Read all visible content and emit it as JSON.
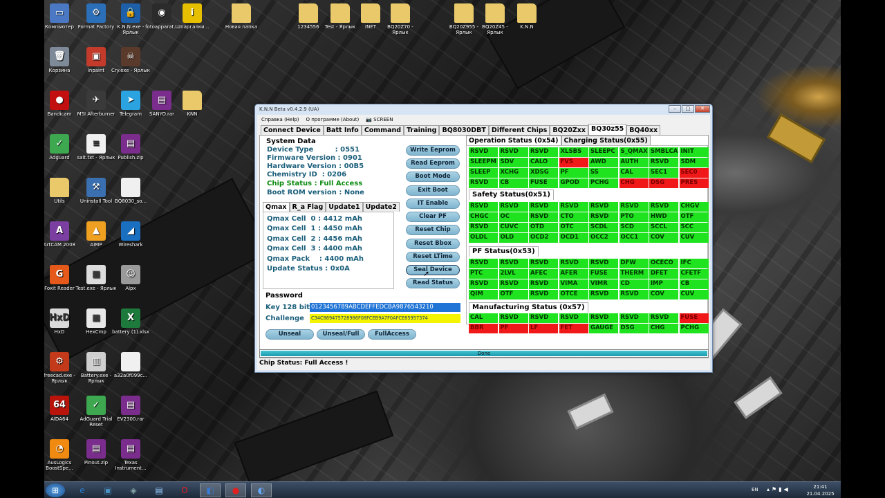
{
  "desktop_icons": [
    {
      "label": "Компьютер",
      "icon": "computer-icon",
      "glyph": "▭",
      "bg": "#4b78c2"
    },
    {
      "label": "Format Factory",
      "icon": "format-factory-icon",
      "glyph": "⚙",
      "bg": "#2a6fb8"
    },
    {
      "label": "K.N.N.exe - Ярлык",
      "icon": "lock-icon",
      "glyph": "🔒",
      "bg": "#1d5fa8"
    },
    {
      "label": "fotoapparat...",
      "icon": "camera-icon",
      "glyph": "◉",
      "bg": "#2b2b2b"
    },
    {
      "label": "Шпаргалки...",
      "icon": "info-icon",
      "glyph": "i",
      "bg": "#e6c000"
    },
    {
      "label": "Новая папка",
      "icon": "folder-icon",
      "glyph": "",
      "bg": "#e9c96a"
    },
    {
      "label": "1234556",
      "icon": "folder-icon",
      "glyph": "",
      "bg": "#e9c96a"
    },
    {
      "label": "Test - Ярлык",
      "icon": "folder-icon",
      "glyph": "",
      "bg": "#e9c96a"
    },
    {
      "label": "INET",
      "icon": "folder-icon",
      "glyph": "",
      "bg": "#e9c96a"
    },
    {
      "label": "BQ20Z70 - Ярлык",
      "icon": "folder-icon",
      "glyph": "",
      "bg": "#e9c96a"
    },
    {
      "label": "BQ20Z955 - Ярлык",
      "icon": "folder-icon",
      "glyph": "",
      "bg": "#e9c96a"
    },
    {
      "label": "BQ20Z45 - Ярлык",
      "icon": "folder-icon",
      "glyph": "",
      "bg": "#e9c96a"
    },
    {
      "label": "K.N.N",
      "icon": "folder-icon",
      "glyph": "",
      "bg": "#e9c96a"
    },
    {
      "label": "Корзина",
      "icon": "recycle-bin-icon",
      "glyph": "🗑",
      "bg": "#7f8a99"
    },
    {
      "label": "Inpaint",
      "icon": "inpaint-icon",
      "glyph": "▣",
      "bg": "#c43b2c"
    },
    {
      "label": "Cry.exe - Ярлык",
      "icon": "cry-icon",
      "glyph": "☠",
      "bg": "#5a3a2a"
    },
    {
      "label": "Bandicam",
      "icon": "bandicam-icon",
      "glyph": "●",
      "bg": "#c21010"
    },
    {
      "label": "MSI Afterburner",
      "icon": "msi-afterburner-icon",
      "glyph": "✈",
      "bg": "#3a3a3a"
    },
    {
      "label": "Telegram",
      "icon": "telegram-icon",
      "glyph": "➤",
      "bg": "#2aa3e0"
    },
    {
      "label": "SANYO.rar",
      "icon": "archive-icon",
      "glyph": "▤",
      "bg": "#7a2d8c"
    },
    {
      "label": "KNN",
      "icon": "folder-icon",
      "glyph": "",
      "bg": "#e9c96a"
    },
    {
      "label": "Adguard",
      "icon": "adguard-icon",
      "glyph": "✓",
      "bg": "#3da84f"
    },
    {
      "label": "sait.txt - Ярлык",
      "icon": "text-file-icon",
      "glyph": "≡",
      "bg": "#f0f0f0"
    },
    {
      "label": "Publish.zip",
      "icon": "archive-icon",
      "glyph": "▤",
      "bg": "#7a2d8c"
    },
    {
      "label": "Utils",
      "icon": "folder-icon",
      "glyph": "",
      "bg": "#e9c96a"
    },
    {
      "label": "Uninstall Tool",
      "icon": "uninstall-tool-icon",
      "glyph": "⚒",
      "bg": "#3a6fb0"
    },
    {
      "label": "BQ8030_so...",
      "icon": "document-icon",
      "glyph": "",
      "bg": "#f0f0f0"
    },
    {
      "label": "ArtCAM 2008",
      "icon": "artcam-icon",
      "glyph": "A",
      "bg": "#7a3fa0"
    },
    {
      "label": "AIMP",
      "icon": "aimp-icon",
      "glyph": "▲",
      "bg": "#f0a020"
    },
    {
      "label": "Wireshark",
      "icon": "wireshark-icon",
      "glyph": "◢",
      "bg": "#1b6fc0"
    },
    {
      "label": "Foxit Reader",
      "icon": "foxit-reader-icon",
      "glyph": "G",
      "bg": "#e55a1a"
    },
    {
      "label": "Test.exe - Ярлык",
      "icon": "app-icon",
      "glyph": "▦",
      "bg": "#dcdcdc"
    },
    {
      "label": "Alpx",
      "icon": "photo-icon",
      "glyph": "☺",
      "bg": "#9a9a9a"
    },
    {
      "label": "HxD",
      "icon": "hxd-icon",
      "glyph": "HxD",
      "bg": "#d9d9d9"
    },
    {
      "label": "HexCmp",
      "icon": "hexcmp-icon",
      "glyph": "▦",
      "bg": "#e8e8e8"
    },
    {
      "label": "battery (1).xlsx",
      "icon": "excel-icon",
      "glyph": "X",
      "bg": "#1e7a3c"
    },
    {
      "label": "freecad.exe - Ярлык",
      "icon": "freecad-icon",
      "glyph": "⚙",
      "bg": "#c23a1a"
    },
    {
      "label": "Battery.exe - Ярлык",
      "icon": "battery-app-icon",
      "glyph": "▥",
      "bg": "#cfcfcf"
    },
    {
      "label": "a32a0f099c...",
      "icon": "document-icon",
      "glyph": "",
      "bg": "#f0f0f0"
    },
    {
      "label": "AIDA64",
      "icon": "aida64-icon",
      "glyph": "64",
      "bg": "#b8140c"
    },
    {
      "label": "AdGuard Trial Reset",
      "icon": "adguard-reset-icon",
      "glyph": "✓",
      "bg": "#3da84f"
    },
    {
      "label": "EV2300.rar",
      "icon": "archive-icon",
      "glyph": "▤",
      "bg": "#7a2d8c"
    },
    {
      "label": "AusLogics BoostSpe...",
      "icon": "auslogics-icon",
      "glyph": "◔",
      "bg": "#f08a10"
    },
    {
      "label": "Pinout.zip",
      "icon": "archive-icon",
      "glyph": "▤",
      "bg": "#7a2d8c"
    },
    {
      "label": "Texas Instrument...",
      "icon": "archive-icon",
      "glyph": "▤",
      "bg": "#7a2d8c"
    }
  ],
  "window": {
    "title": "K.N.N Beta v0.4.2.9 (UA)",
    "menu": [
      "Справка (Help)",
      "О программе (About)",
      "SCREEN"
    ],
    "tabs": [
      "Connect Device",
      "Batt Info",
      "Command",
      "Training",
      "BQ8030DBT",
      "Different Chips",
      "BQ20Zxx",
      "BQ30z55",
      "BQ40xx"
    ],
    "active_tab": "BQ30z55"
  },
  "system_data": {
    "title": "System Data",
    "device_type": "Device Type         : 0551",
    "firmware": "Firmware Version : 0901",
    "hardware": "Hardware Version : 00B5",
    "chemistry": "Chemistry ID  : 0206",
    "chip_status": "Chip Status : Full Access",
    "boot_rom": "Boot ROM version : None"
  },
  "qmax": {
    "tabs": [
      "Qmax",
      "R_a Flag",
      "Update1",
      "Update2"
    ],
    "lines": [
      "Qmax Cell  0 : 4412 mAh",
      "Qmax Cell  1 : 4450 mAh",
      "Qmax Cell  2 : 4456 mAh",
      "Qmax Cell  3 : 4400 mAh",
      "Qmax Pack    : 4400 mAh",
      "Update Status : 0x0A"
    ]
  },
  "command_buttons": [
    "Write Eeprom",
    "Read Eeprom",
    "Boot Mode",
    "Exit Boot",
    "IT Enable",
    "Clear PF",
    "Reset Chip",
    "Reset Bbox",
    "Reset LTime",
    "Seal Device",
    "Read Status"
  ],
  "password": {
    "title": "Password",
    "key_label": "Key 128 bit :",
    "key_value": "0123456789ABCDEFFEDCBA9876543210",
    "challenge_label": "Challenge    :",
    "challenge_value": "C34C869475728986F08FCEB9A7F0AFCE85957374",
    "buttons": [
      "Unseal",
      "Unseal/Full",
      "FullAccess"
    ]
  },
  "status_tabs": [
    "Operation Status (0x54)",
    "Charging Status(0x55)"
  ],
  "operation_status": [
    [
      "RSVD",
      "g"
    ],
    [
      "RSVD",
      "g"
    ],
    [
      "RSVD",
      "g"
    ],
    [
      "XLSBS",
      "g"
    ],
    [
      "SLEEPC",
      "g"
    ],
    [
      "S_QMAX",
      "g"
    ],
    [
      "SMBLCA",
      "g"
    ],
    [
      "INIT",
      "g"
    ],
    [
      "SLEEPM",
      "g"
    ],
    [
      "SDV",
      "g"
    ],
    [
      "CALO",
      "g"
    ],
    [
      "FVS",
      "r"
    ],
    [
      "AWD",
      "g"
    ],
    [
      "AUTH",
      "g"
    ],
    [
      "RSVD",
      "g"
    ],
    [
      "SDM",
      "g"
    ],
    [
      "SLEEP",
      "g"
    ],
    [
      "XCHG",
      "g"
    ],
    [
      "XDSG",
      "g"
    ],
    [
      "PF",
      "g"
    ],
    [
      "SS",
      "g"
    ],
    [
      "CAL",
      "g"
    ],
    [
      "SEC1",
      "g"
    ],
    [
      "SEC0",
      "r"
    ],
    [
      "RSVD",
      "g"
    ],
    [
      "CB",
      "g"
    ],
    [
      "FUSE",
      "g"
    ],
    [
      "GPOD",
      "g"
    ],
    [
      "PCHG",
      "g"
    ],
    [
      "CHG",
      "r"
    ],
    [
      "DSG",
      "r"
    ],
    [
      "PRES",
      "r"
    ]
  ],
  "safety_status_title": "Safety Status(0x51)",
  "safety_status": [
    [
      "RSVD",
      "g"
    ],
    [
      "RSVD",
      "g"
    ],
    [
      "RSVD",
      "g"
    ],
    [
      "RSVD",
      "g"
    ],
    [
      "RSVD",
      "g"
    ],
    [
      "RSVD",
      "g"
    ],
    [
      "RSVD",
      "g"
    ],
    [
      "CHGV",
      "g"
    ],
    [
      "CHGC",
      "g"
    ],
    [
      "OC",
      "g"
    ],
    [
      "RSVD",
      "g"
    ],
    [
      "CTO",
      "g"
    ],
    [
      "RSVD",
      "g"
    ],
    [
      "PTO",
      "g"
    ],
    [
      "HWD",
      "g"
    ],
    [
      "OTF",
      "g"
    ],
    [
      "RSVD",
      "g"
    ],
    [
      "CUVC",
      "g"
    ],
    [
      "OTD",
      "g"
    ],
    [
      "OTC",
      "g"
    ],
    [
      "SCDL",
      "g"
    ],
    [
      "SCD",
      "g"
    ],
    [
      "SCCL",
      "g"
    ],
    [
      "SCC",
      "g"
    ],
    [
      "OLDL",
      "g"
    ],
    [
      "OLD",
      "g"
    ],
    [
      "OCD2",
      "g"
    ],
    [
      "OCD1",
      "g"
    ],
    [
      "OCC2",
      "g"
    ],
    [
      "OCC1",
      "g"
    ],
    [
      "COV",
      "g"
    ],
    [
      "CUV",
      "g"
    ]
  ],
  "pf_status_title": "PF Status(0x53)",
  "pf_status": [
    [
      "RSVD",
      "g"
    ],
    [
      "RSVD",
      "g"
    ],
    [
      "RSVD",
      "g"
    ],
    [
      "RSVD",
      "g"
    ],
    [
      "RSVD",
      "g"
    ],
    [
      "DFW",
      "g"
    ],
    [
      "OCECO",
      "g"
    ],
    [
      "IFC",
      "g"
    ],
    [
      "PTC",
      "g"
    ],
    [
      "2LVL",
      "g"
    ],
    [
      "AFEC",
      "g"
    ],
    [
      "AFER",
      "g"
    ],
    [
      "FUSE",
      "g"
    ],
    [
      "THERM",
      "g"
    ],
    [
      "DFET",
      "g"
    ],
    [
      "CFETF",
      "g"
    ],
    [
      "RSVD",
      "g"
    ],
    [
      "RSVD",
      "g"
    ],
    [
      "RSVD",
      "g"
    ],
    [
      "VIMA",
      "g"
    ],
    [
      "VIMR",
      "g"
    ],
    [
      "CD",
      "g"
    ],
    [
      "IMP",
      "g"
    ],
    [
      "CB",
      "g"
    ],
    [
      "QIM",
      "g"
    ],
    [
      "OTF",
      "g"
    ],
    [
      "RSVD",
      "g"
    ],
    [
      "OTCE",
      "g"
    ],
    [
      "RSVD",
      "g"
    ],
    [
      "RSVD",
      "g"
    ],
    [
      "COV",
      "g"
    ],
    [
      "CUV",
      "g"
    ]
  ],
  "mfg_status_title": "Manufacturing Status (0x57)",
  "mfg_status": [
    [
      "CAL",
      "g"
    ],
    [
      "RSVD",
      "g"
    ],
    [
      "RSVD",
      "g"
    ],
    [
      "RSVD",
      "g"
    ],
    [
      "RSVD",
      "g"
    ],
    [
      "RSVD",
      "g"
    ],
    [
      "RSVD",
      "g"
    ],
    [
      "FUSE",
      "r"
    ],
    [
      "BBR",
      "r"
    ],
    [
      "PF",
      "r"
    ],
    [
      "LF",
      "r"
    ],
    [
      "FET",
      "r"
    ],
    [
      "GAUGE",
      "g"
    ],
    [
      "DSG",
      "g"
    ],
    [
      "CHG",
      "g"
    ],
    [
      "PCHG",
      "g"
    ]
  ],
  "progress": {
    "label": "Done",
    "fraction": 1.0
  },
  "statusbar": "Chip Status: Full Access !",
  "tray": {
    "lang": "EN",
    "time": "21:41",
    "date": "21.04.2025"
  },
  "taskbar_apps": [
    "ie-icon",
    "explorer-icon",
    "hxd-task-icon",
    "notepad-icon",
    "opera-icon",
    "knn-task-icon",
    "bandicam-task-icon",
    "screen-task-icon"
  ]
}
